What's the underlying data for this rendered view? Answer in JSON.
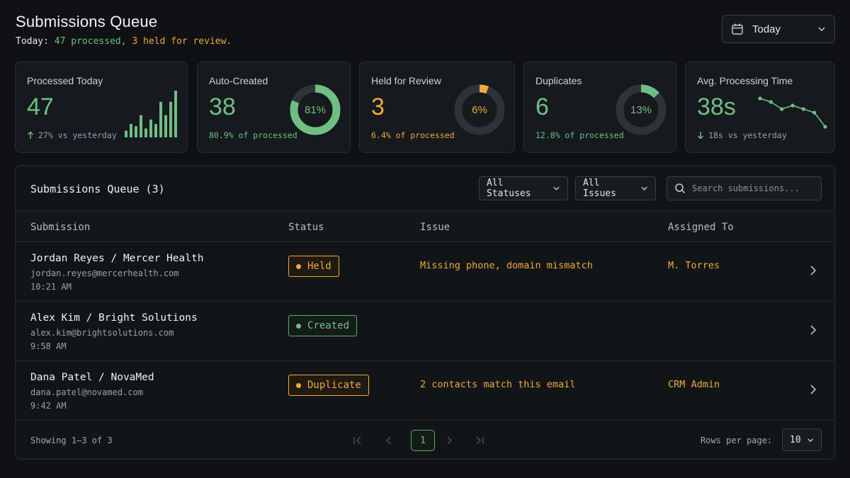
{
  "header": {
    "title": "Submissions Queue",
    "subtitle_label": "Today:",
    "subtitle_processed": "47 processed,",
    "subtitle_held": "3 held for review.",
    "date_filter": "Today"
  },
  "cards": {
    "processed": {
      "title": "Processed Today",
      "value": "47",
      "sub": "27% vs yesterday",
      "trend_icon": "arrow-up-icon",
      "bars": [
        3,
        6,
        5,
        10,
        4,
        8,
        6,
        16,
        10,
        16,
        21
      ]
    },
    "auto_created": {
      "title": "Auto-Created",
      "value": "38",
      "sub": "80.9% of processed",
      "percent_label": "81%",
      "percent": 81
    },
    "held": {
      "title": "Held for Review",
      "value": "3",
      "sub": "6.4% of processed",
      "percent_label": "6%",
      "percent": 6
    },
    "duplicates": {
      "title": "Duplicates",
      "value": "6",
      "sub": "12.8% of processed",
      "percent_label": "13%",
      "percent": 13
    },
    "avg_time": {
      "title": "Avg. Processing Time",
      "value": "38s",
      "sub": "18s vs yesterday",
      "trend_icon": "arrow-down-icon",
      "trend": [
        10,
        9,
        7,
        8,
        7,
        6,
        2
      ]
    }
  },
  "queue": {
    "title": "Submissions Queue (3)",
    "status_filter": "All Statuses",
    "issue_filter": "All Issues",
    "search_placeholder": "Search submissions...",
    "columns": [
      "Submission",
      "Status",
      "Issue",
      "Assigned To"
    ],
    "rows": [
      {
        "name": "Jordan Reyes / Mercer Health",
        "email": "jordan.reyes@mercerhealth.com",
        "time": "10:21 AM",
        "status": "Held",
        "issue": "Missing phone, domain mismatch",
        "assignee": "M. Torres"
      },
      {
        "name": "Alex Kim / Bright Solutions",
        "email": "alex.kim@brightsolutions.com",
        "time": "9:58 AM",
        "status": "Created",
        "issue": "",
        "assignee": ""
      },
      {
        "name": "Dana Patel / NovaMed",
        "email": "dana.patel@novamed.com",
        "time": "9:42 AM",
        "status": "Duplicate",
        "issue": "2 contacts match this email",
        "assignee": "CRM Admin"
      }
    ],
    "showing": "Showing 1–3 of 3",
    "current_page": "1",
    "rows_per_page_label": "Rows per page:",
    "rows_per_page": "10"
  },
  "colors": {
    "green": "#6fbf84",
    "amber": "#f0a93a",
    "track": "#2e3338"
  }
}
